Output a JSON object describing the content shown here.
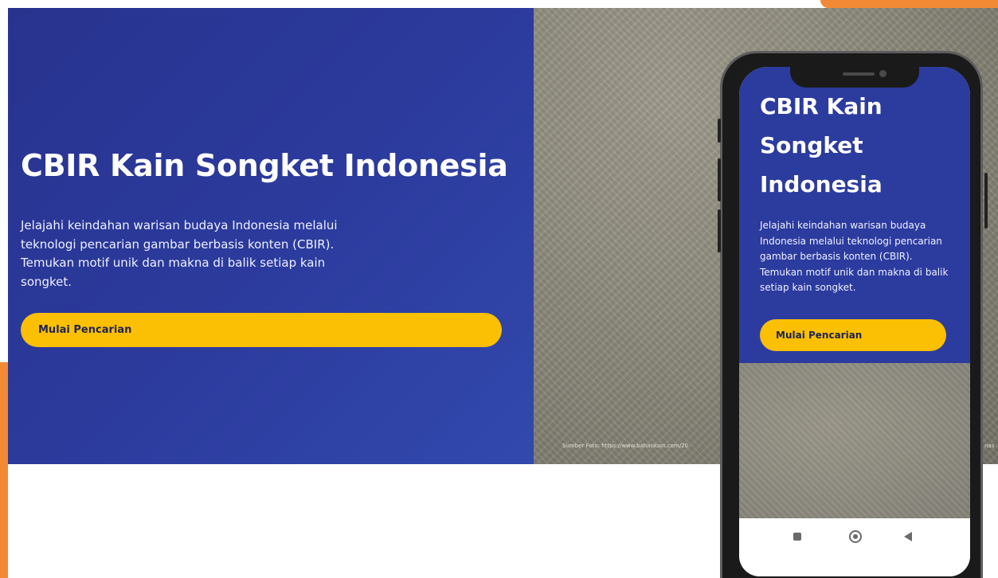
{
  "hero": {
    "title": "CBIR Kain Songket Indonesia",
    "description": "Jelajahi keindahan warisan budaya Indonesia melalui teknologi pencarian gambar berbasis konten (CBIR). Temukan motif unik dan makna di balik setiap kain songket.",
    "button_label": "Mulai Pencarian",
    "photo_credit": "Sumber Foto: https://www.bahankain.com/20",
    "photo_credit_tail": "nas"
  },
  "mobile": {
    "title": "CBIR Kain Songket Indonesia",
    "description": "Jelajahi keindahan warisan budaya Indonesia melalui teknologi pencarian gambar berbasis konten (CBIR). Temukan motif unik dan makna di balik setiap kain songket.",
    "button_label": "Mulai Pencarian",
    "nav_icons": [
      "recent-apps-icon",
      "home-icon",
      "back-icon"
    ]
  },
  "colors": {
    "primary_blue": "#2c3b9e",
    "button_yellow": "#fbbf04",
    "accent_orange": "#f28a35"
  }
}
